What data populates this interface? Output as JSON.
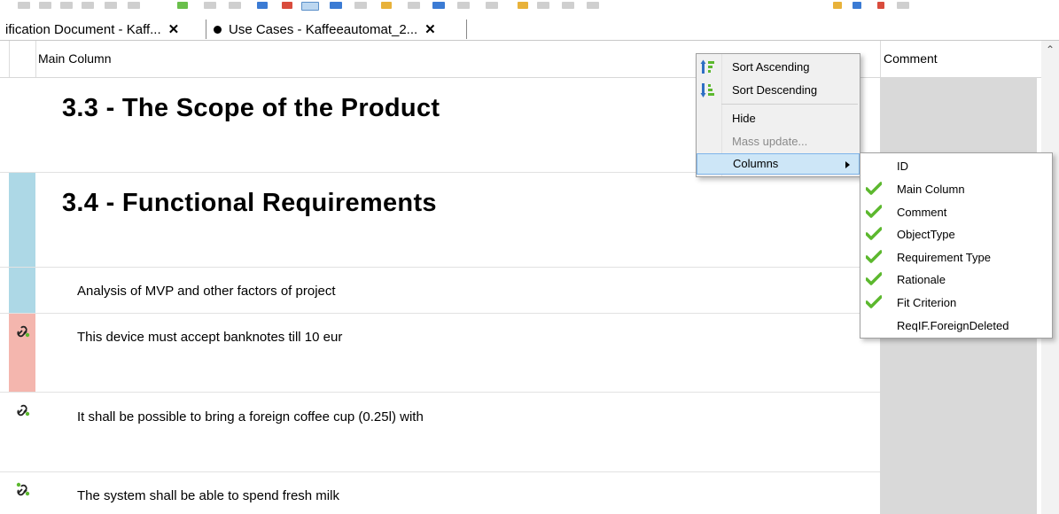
{
  "tabs": [
    {
      "label": "ification Document - Kaff...",
      "close": "✕",
      "modified": false
    },
    {
      "label": "Use Cases - Kaffeeautomat_2...",
      "close": "✕",
      "modified": true
    }
  ],
  "table": {
    "columns": [
      "Main Column",
      "Comment"
    ],
    "rows": [
      {
        "kind": "heading",
        "text": "3.3 - The Scope of the Product",
        "marker": "none"
      },
      {
        "kind": "heading",
        "text": "3.4 - Functional Requirements",
        "marker": "#add8e6"
      },
      {
        "kind": "text",
        "text": "Analysis of MVP and other factors of project",
        "marker": "#add8e6"
      },
      {
        "kind": "text",
        "text": "This device must accept banknotes till 10 eur",
        "marker": "#f4b6ae",
        "icon": "link-icon"
      },
      {
        "kind": "text",
        "text": "It shall be possible to bring a foreign coffee cup (0.25l) with",
        "marker": "none",
        "icon": "link-icon"
      },
      {
        "kind": "text",
        "text": "The system shall be able to spend fresh milk",
        "marker": "none",
        "icon": "link-icon"
      }
    ]
  },
  "context_menu": {
    "items": [
      {
        "label": "Sort Ascending",
        "icon": "sort-ascending-icon"
      },
      {
        "label": "Sort Descending",
        "icon": "sort-descending-icon"
      },
      {
        "label": "Hide"
      },
      {
        "label": "Mass update...",
        "disabled": true
      },
      {
        "label": "Columns",
        "submenu": true,
        "active": true
      }
    ]
  },
  "columns_menu": {
    "items": [
      {
        "label": "ID",
        "checked": false
      },
      {
        "label": "Main Column",
        "checked": true
      },
      {
        "label": "Comment",
        "checked": true
      },
      {
        "label": "ObjectType",
        "checked": true
      },
      {
        "label": "Requirement Type",
        "checked": true
      },
      {
        "label": "Rationale",
        "checked": true
      },
      {
        "label": "Fit Criterion",
        "checked": true
      },
      {
        "label": "ReqIF.ForeignDeleted",
        "checked": false
      }
    ]
  },
  "colors": {
    "marker_blue": "#add8e6",
    "marker_red": "#f4b6ae",
    "comment_bg": "#d9d9d9",
    "check_green": "#5cb82e",
    "menu_highlight": "#cde6f7"
  }
}
